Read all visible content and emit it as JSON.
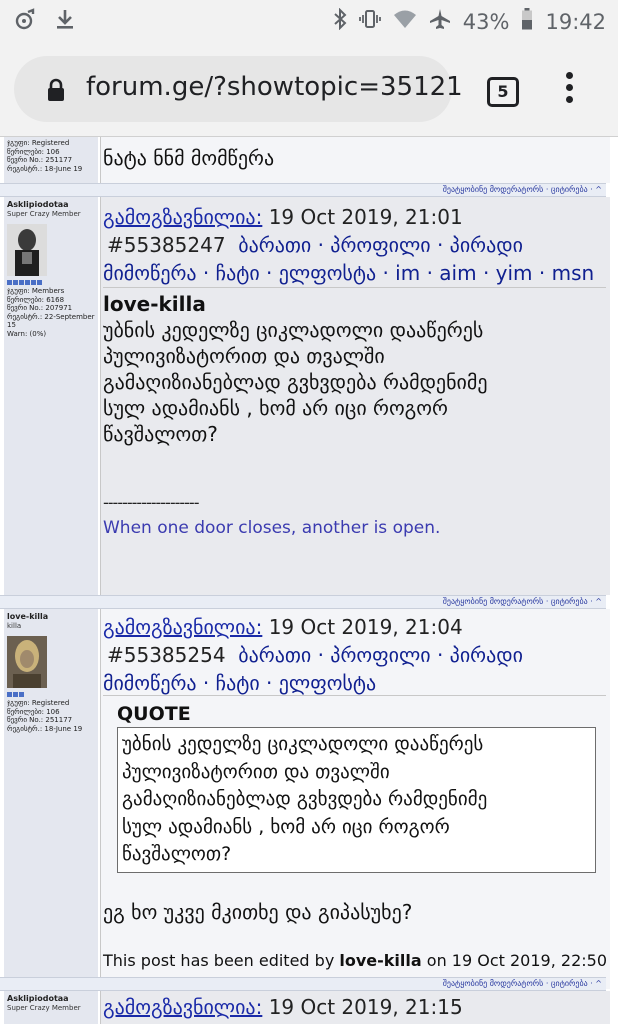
{
  "statusbar": {
    "battery": "43%",
    "time": "19:42"
  },
  "browser": {
    "url": "forum.ge/?showtopic=35121",
    "tab_count": "5"
  },
  "post0": {
    "meta": [
      "ჯგუფი: Registered",
      "წერილები: 106",
      "წევრი No.: 251177",
      "რეგისტრ.: 18-June 19"
    ],
    "body": "ნატა ნნმ მომწერა",
    "footer": "შეატყობინე მოდერატორს · ციტირება · ^"
  },
  "post1": {
    "username": "Asklipiodotaa",
    "user_title": "Super Crazy Member",
    "meta": [
      "ჯგუფი: Members",
      "წერილები: 6168",
      "წევრი No.: 207971",
      "რეგისტრ.: 22-September 15",
      "Warn: (0%)"
    ],
    "sent_label": "გამოგზავნილია:",
    "datetime": "19 Oct 2019, 21:01",
    "post_id": "#55385247",
    "links": "ბარათი · პროფილი · პირადი",
    "links2": "მიმოწერა · ჩატი · ელფოსტა · im · aim · yim · msn",
    "quoted_author": "love-killa",
    "body_lines": [
      "უბნის კედელზე ციკლადოლი დააწერეს",
      "პულივიზატორით და თვალში",
      "გამაღიზიანებლად გვხვდება რამდენიმე",
      "სულ ადამიანს , ხომ არ იცი როგორ",
      "წავშალოთ?"
    ],
    "sig_dash": "--------------------",
    "signature": "When one door closes, another is open.",
    "footer": "შეატყობინე მოდერატორს · ციტირება · ^"
  },
  "post2": {
    "username": "love-killa",
    "user_title": "killa",
    "meta": [
      "ჯგუფი: Registered",
      "წერილები: 106",
      "წევრი No.: 251177",
      "რეგისტრ.: 18-June 19"
    ],
    "sent_label": "გამოგზავნილია:",
    "datetime": "19 Oct 2019, 21:04",
    "post_id": "#55385254",
    "links": "ბარათი · პროფილი · პირადი",
    "links2": "მიმოწერა · ჩატი · ელფოსტა",
    "quote_label": "QUOTE",
    "quote_lines": [
      "უბნის კედელზე ციკლადოლი დააწერეს",
      "პულივიზატორით და თვალში",
      "გამაღიზიანებლად გვხვდება რამდენიმე",
      "სულ ადამიანს , ხომ არ იცი როგორ",
      "წავშალოთ?"
    ],
    "reply": "ეგ ხო უკვე მკითხე და გიპასუხე?",
    "edited_prefix": "This post has been edited by",
    "edited_by": "love-killa",
    "edited_suffix": "on 19 Oct 2019, 22:50",
    "footer": "შეატყობინე მოდერატორს · ციტირება · ^"
  },
  "post3": {
    "username": "Asklipiodotaa",
    "user_title": "Super Crazy Member",
    "sent_label": "გამოგზავნილია:",
    "datetime": "19 Oct 2019, 21:15"
  }
}
